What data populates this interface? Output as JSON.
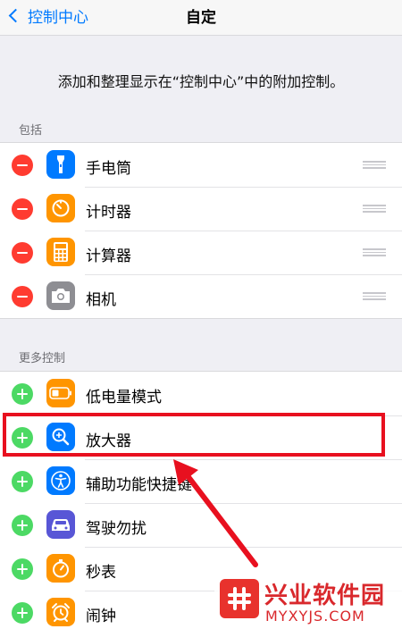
{
  "navbar": {
    "back_label": "控制中心",
    "title": "自定"
  },
  "description": "添加和整理显示在“控制中心”中的附加控制。",
  "include_section": {
    "header": "包括",
    "items": [
      {
        "label": "手电筒",
        "icon": "flashlight-icon",
        "icon_color": "#007aff"
      },
      {
        "label": "计时器",
        "icon": "timer-icon",
        "icon_color": "#ff9500"
      },
      {
        "label": "计算器",
        "icon": "calculator-icon",
        "icon_color": "#ff9500"
      },
      {
        "label": "相机",
        "icon": "camera-icon",
        "icon_color": "#8e8e93"
      }
    ]
  },
  "more_section": {
    "header": "更多控制",
    "items": [
      {
        "label": "低电量模式",
        "icon": "battery-icon",
        "icon_color": "#ff9500"
      },
      {
        "label": "放大器",
        "icon": "magnifier-icon",
        "icon_color": "#007aff"
      },
      {
        "label": "辅助功能快捷键",
        "icon": "accessibility-icon",
        "icon_color": "#007aff"
      },
      {
        "label": "驾驶勿扰",
        "icon": "car-icon",
        "icon_color": "#5856d6"
      },
      {
        "label": "秒表",
        "icon": "stopwatch-icon",
        "icon_color": "#ff9500"
      },
      {
        "label": "闹钟",
        "icon": "alarm-icon",
        "icon_color": "#ff9500"
      }
    ]
  },
  "colors": {
    "remove": "#ff3b30",
    "add": "#4cd964",
    "accent": "#007aff",
    "highlight": "#e8101f"
  },
  "watermark": {
    "title": "兴业软件园",
    "domain": "MYXYJS.COM"
  }
}
